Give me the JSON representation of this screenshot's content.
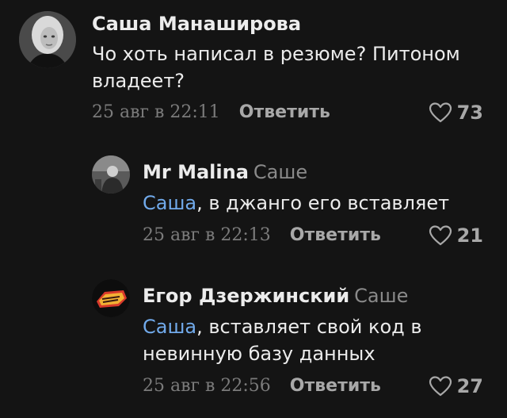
{
  "comments": [
    {
      "author": "Саша Манаширова",
      "reply_to": "",
      "mention": "",
      "separator": "",
      "text_lines": [
        "Чо хоть написал в резюме? Питоном",
        "владеет?"
      ],
      "time": "25 авг в 22:11",
      "reply_label": "Ответить",
      "likes": "73",
      "avatar_icon": "user-photo-avatar"
    },
    {
      "author": "Mr Malina",
      "reply_to": "Саше",
      "mention": "Саша",
      "separator": ", ",
      "text_lines": [
        "в джанго его вставляет"
      ],
      "time": "25 авг в 22:13",
      "reply_label": "Ответить",
      "likes": "21",
      "avatar_icon": "user-photo-avatar"
    },
    {
      "author": "Егор Дзержинский",
      "reply_to": "Саше",
      "mention": "Саша",
      "separator": ", ",
      "text_lines": [
        "вставляет свой код в",
        "невинную базу данных"
      ],
      "time": "25 авг в 22:56",
      "reply_label": "Ответить",
      "likes": "27",
      "avatar_icon": "sticker-avatar"
    }
  ],
  "colors": {
    "background": "#141414",
    "mention": "#71aaeb",
    "muted": "#7b7b7b",
    "action": "#a8a8a8"
  }
}
